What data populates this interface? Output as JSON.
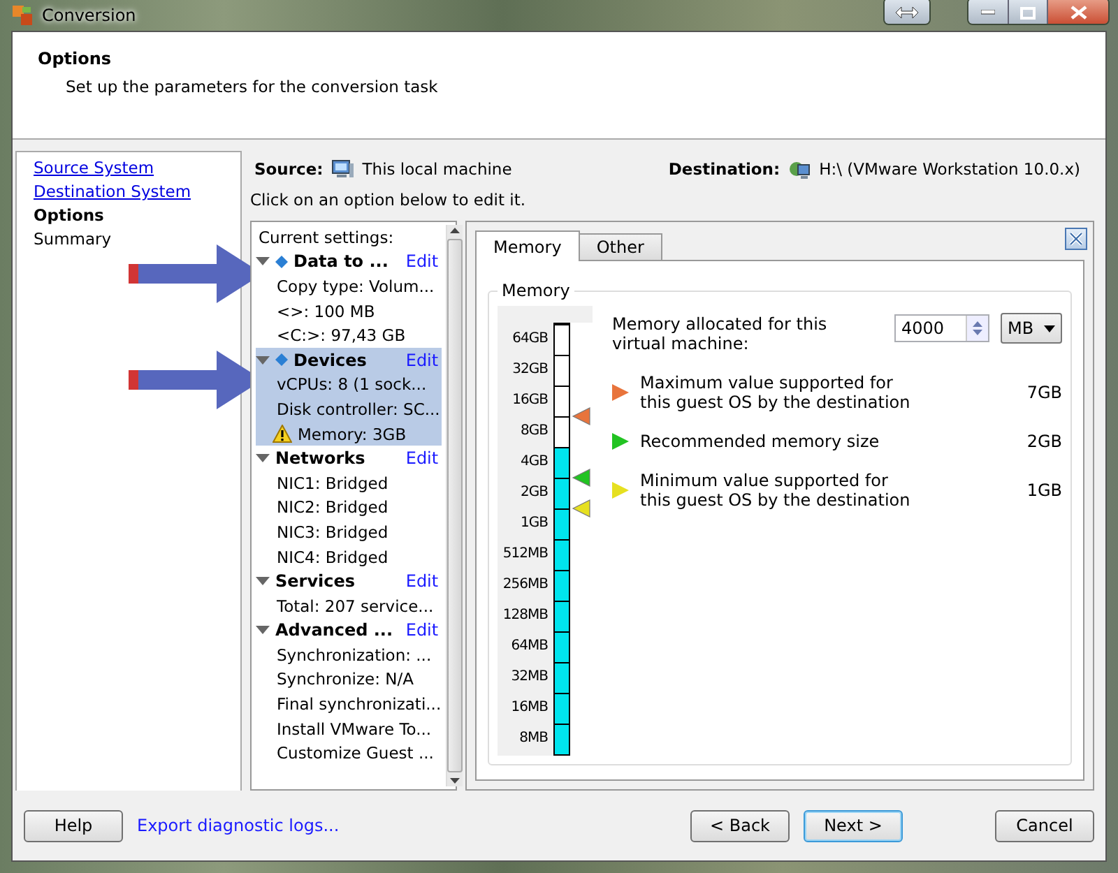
{
  "window": {
    "title": "Conversion"
  },
  "header": {
    "title": "Options",
    "subtitle": "Set up the parameters for the conversion task"
  },
  "nav": [
    {
      "label": "Source System",
      "link": true,
      "selected": false
    },
    {
      "label": "Destination System",
      "link": true,
      "selected": false
    },
    {
      "label": "Options",
      "link": false,
      "selected": true
    },
    {
      "label": "Summary",
      "link": false,
      "selected": false
    }
  ],
  "source": {
    "label": "Source:",
    "value": "This local machine"
  },
  "destination": {
    "label": "Destination:",
    "value": "H:\\ (VMware Workstation 10.0.x)"
  },
  "hint": "Click on an option below to edit it.",
  "settings": {
    "title": "Current settings:",
    "groups": [
      {
        "title": "Data to ...",
        "diamond": true,
        "expanded": true,
        "selected": false,
        "edit": "Edit",
        "items": [
          {
            "text": "Copy type: Volum...",
            "warning": false
          },
          {
            "text": "<>: 100 MB",
            "warning": false
          },
          {
            "text": "<C:>: 97,43 GB",
            "warning": false
          }
        ]
      },
      {
        "title": "Devices",
        "diamond": true,
        "expanded": true,
        "selected": true,
        "edit": "Edit",
        "items": [
          {
            "text": "vCPUs: 8 (1 sock...",
            "warning": false
          },
          {
            "text": "Disk controller: SC...",
            "warning": false
          },
          {
            "text": "Memory: 3GB",
            "warning": true
          }
        ]
      },
      {
        "title": "Networks",
        "diamond": false,
        "expanded": true,
        "selected": false,
        "edit": "Edit",
        "items": [
          {
            "text": "NIC1: Bridged",
            "warning": false
          },
          {
            "text": "NIC2: Bridged",
            "warning": false
          },
          {
            "text": "NIC3: Bridged",
            "warning": false
          },
          {
            "text": "NIC4: Bridged",
            "warning": false
          }
        ]
      },
      {
        "title": "Services",
        "diamond": false,
        "expanded": true,
        "selected": false,
        "edit": "Edit",
        "items": [
          {
            "text": "Total: 207 service...",
            "warning": false
          }
        ]
      },
      {
        "title": "Advanced ...",
        "diamond": false,
        "expanded": true,
        "selected": false,
        "edit": "Edit",
        "items": [
          {
            "text": "Synchronization: ...",
            "warning": false
          },
          {
            "text": "Synchronize: N/A",
            "warning": false
          },
          {
            "text": "Final synchronizati...",
            "warning": false
          },
          {
            "text": "Install VMware To...",
            "warning": false
          },
          {
            "text": "Customize Guest ...",
            "warning": false
          }
        ]
      }
    ]
  },
  "tabs": [
    {
      "label": "Memory",
      "selected": true
    },
    {
      "label": "Other",
      "selected": false
    }
  ],
  "memory": {
    "group_title": "Memory",
    "scale": [
      "64GB",
      "32GB",
      "16GB",
      "8GB",
      "4GB",
      "2GB",
      "1GB",
      "512MB",
      "256MB",
      "128MB",
      "64MB",
      "32MB",
      "16MB",
      "8MB"
    ],
    "level": 0.714,
    "allocated_label": "Memory allocated for this virtual machine:",
    "value": "4000",
    "unit": "MB",
    "markers": [
      {
        "color": "#e8743c",
        "level": 0.786
      },
      {
        "color": "#22c322",
        "level": 0.643
      },
      {
        "color": "#e6e020",
        "level": 0.571
      }
    ],
    "limits": [
      {
        "text": "Maximum value supported for this guest OS by the destination",
        "value": "7GB",
        "color": "#e8743c"
      },
      {
        "text": "Recommended memory size",
        "value": "2GB",
        "color": "#22c322"
      },
      {
        "text": "Minimum value supported for this guest OS by the destination",
        "value": "1GB",
        "color": "#e6e020"
      }
    ]
  },
  "footer": {
    "help": "Help",
    "export": "Export diagnostic logs...",
    "back": "< Back",
    "next": "Next >",
    "cancel": "Cancel"
  }
}
